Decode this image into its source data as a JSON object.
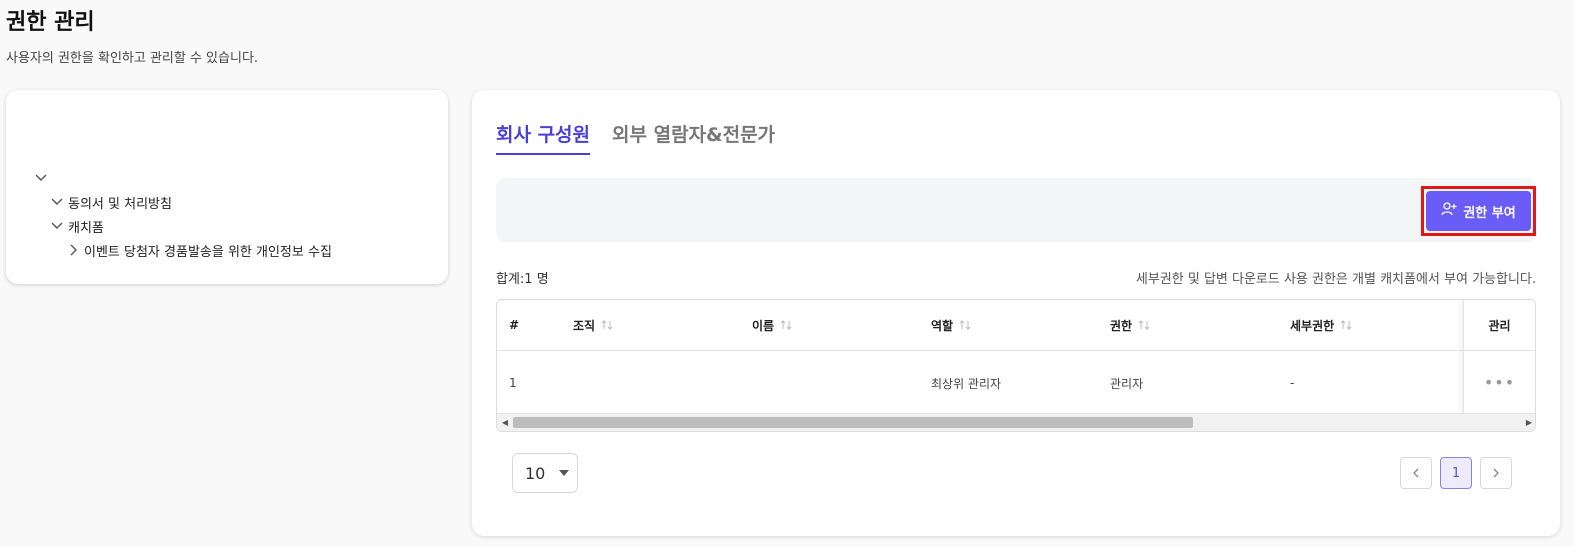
{
  "page": {
    "title": "권한 관리",
    "subtitle": "사용자의 권한을 확인하고 관리할 수 있습니다."
  },
  "tree": {
    "items": [
      {
        "label": "",
        "expanded": true,
        "icon": "chevron-down-icon"
      },
      {
        "label": "동의서 및 처리방침",
        "expanded": true,
        "icon": "chevron-down-icon"
      },
      {
        "label": "캐치폼",
        "expanded": true,
        "icon": "chevron-down-icon"
      },
      {
        "label": "이벤트 당첨자 경품발송을 위한 개인정보 수집",
        "expanded": false,
        "icon": "chevron-right-icon"
      }
    ]
  },
  "tabs": [
    {
      "label": "회사 구성원",
      "active": true
    },
    {
      "label": "외부 열람자&전문가",
      "active": false
    }
  ],
  "toolbar": {
    "grant_label": "권한 부여",
    "grant_icon": "user-plus-icon",
    "accent_color": "#6a5cf6",
    "highlight_color": "#e01818"
  },
  "summary": {
    "total": "합계:1 명",
    "notice": "세부권한 및 답변 다운로드 사용 권한은 개별 캐치폼에서 부여 가능합니다."
  },
  "table": {
    "headers": {
      "index": "#",
      "org": "조직",
      "name": "이름",
      "role": "역할",
      "perm": "권한",
      "detail": "세부권한",
      "manage": "관리"
    },
    "rows": [
      {
        "index": "1",
        "org": "",
        "name": "",
        "role": "최상위 관리자",
        "perm": "관리자",
        "detail": "-",
        "manage": "•••"
      }
    ]
  },
  "pagination": {
    "page_size": "10",
    "current_page": "1"
  }
}
